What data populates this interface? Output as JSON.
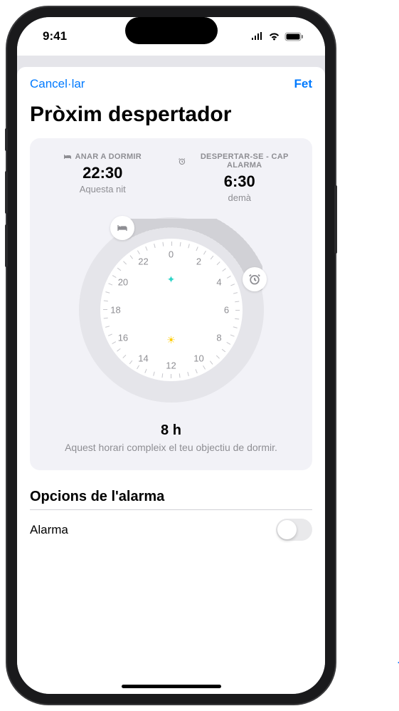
{
  "status": {
    "time": "9:41"
  },
  "nav": {
    "cancel": "Cancel·lar",
    "done": "Fet"
  },
  "title": "Pròxim despertador",
  "sleep": {
    "bedtime": {
      "label": "ANAR A DORMIR",
      "value": "22:30",
      "sub": "Aquesta nit",
      "icon": "bed-icon"
    },
    "wake": {
      "label": "DESPERTAR-SE - CAP ALARMA",
      "value": "6:30",
      "sub": "demà",
      "icon": "alarm-icon"
    },
    "dial": {
      "hours": [
        "0",
        "2",
        "4",
        "6",
        "8",
        "10",
        "12",
        "14",
        "16",
        "18",
        "20",
        "22"
      ]
    },
    "summary": {
      "hours": "8 h",
      "text": "Aquest horari compleix el teu objectiu de dormir."
    }
  },
  "options": {
    "header": "Opcions de l'alarma",
    "alarm_label": "Alarma",
    "alarm_on": false
  }
}
